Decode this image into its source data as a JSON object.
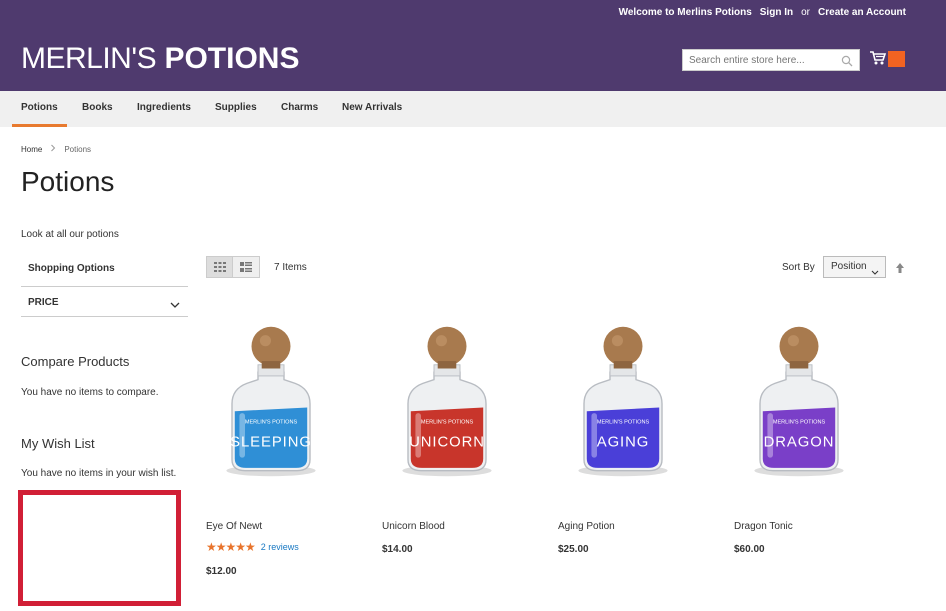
{
  "header": {
    "welcome": "Welcome to Merlins Potions",
    "sign_in": "Sign In",
    "or": "or",
    "create_account": "Create an Account",
    "logo_light": "MERLIN'S",
    "logo_bold": "POTIONS",
    "search_placeholder": "Search entire store here...",
    "brand_color": "#4f3a6e",
    "accent_color": "#f26322"
  },
  "nav": {
    "items": [
      "Potions",
      "Books",
      "Ingredients",
      "Supplies",
      "Charms",
      "New Arrivals"
    ],
    "active": "Potions"
  },
  "breadcrumb": {
    "home": "Home",
    "current": "Potions"
  },
  "page": {
    "title": "Potions",
    "intro": "Look at all our potions"
  },
  "sidebar": {
    "shopping_options": "Shopping Options",
    "price_filter": "PRICE",
    "compare_title": "Compare Products",
    "compare_text": "You have no items to compare.",
    "wish_title": "My Wish List",
    "wish_text": "You have no items in your wish list."
  },
  "toolbar": {
    "item_count": "7 Items",
    "sort_label": "Sort By",
    "sort_value": "Position"
  },
  "products": [
    {
      "name": "Eye Of Newt",
      "price": "$12.00",
      "label": "SLEEPING",
      "color": "#2f8fd6",
      "rating_stars": 5,
      "reviews": "2 reviews"
    },
    {
      "name": "Unicorn Blood",
      "price": "$14.00",
      "label": "UNICORN",
      "color": "#c8352b"
    },
    {
      "name": "Aging Potion",
      "price": "$25.00",
      "label": "AGING",
      "color": "#4a3fd8"
    },
    {
      "name": "Dragon Tonic",
      "price": "$60.00",
      "label": "DRAGON",
      "color": "#7a3fc8"
    }
  ],
  "bottle_brand": "MERLIN'S POTIONS"
}
